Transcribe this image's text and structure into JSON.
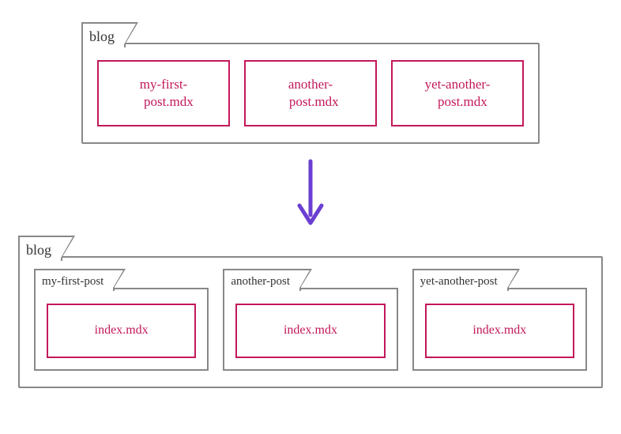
{
  "top": {
    "folder_label": "blog",
    "files": [
      "my-first-\n   post.mdx",
      "another-\n  post.mdx",
      "yet-another-\n   post.mdx"
    ]
  },
  "bottom": {
    "folder_label": "blog",
    "subfolders": [
      {
        "label": "my-first-post",
        "file": "index.mdx"
      },
      {
        "label": "another-post",
        "file": "index.mdx"
      },
      {
        "label": "yet-another-post",
        "file": "index.mdx"
      }
    ]
  },
  "arrow_color": "#6b3fd1"
}
